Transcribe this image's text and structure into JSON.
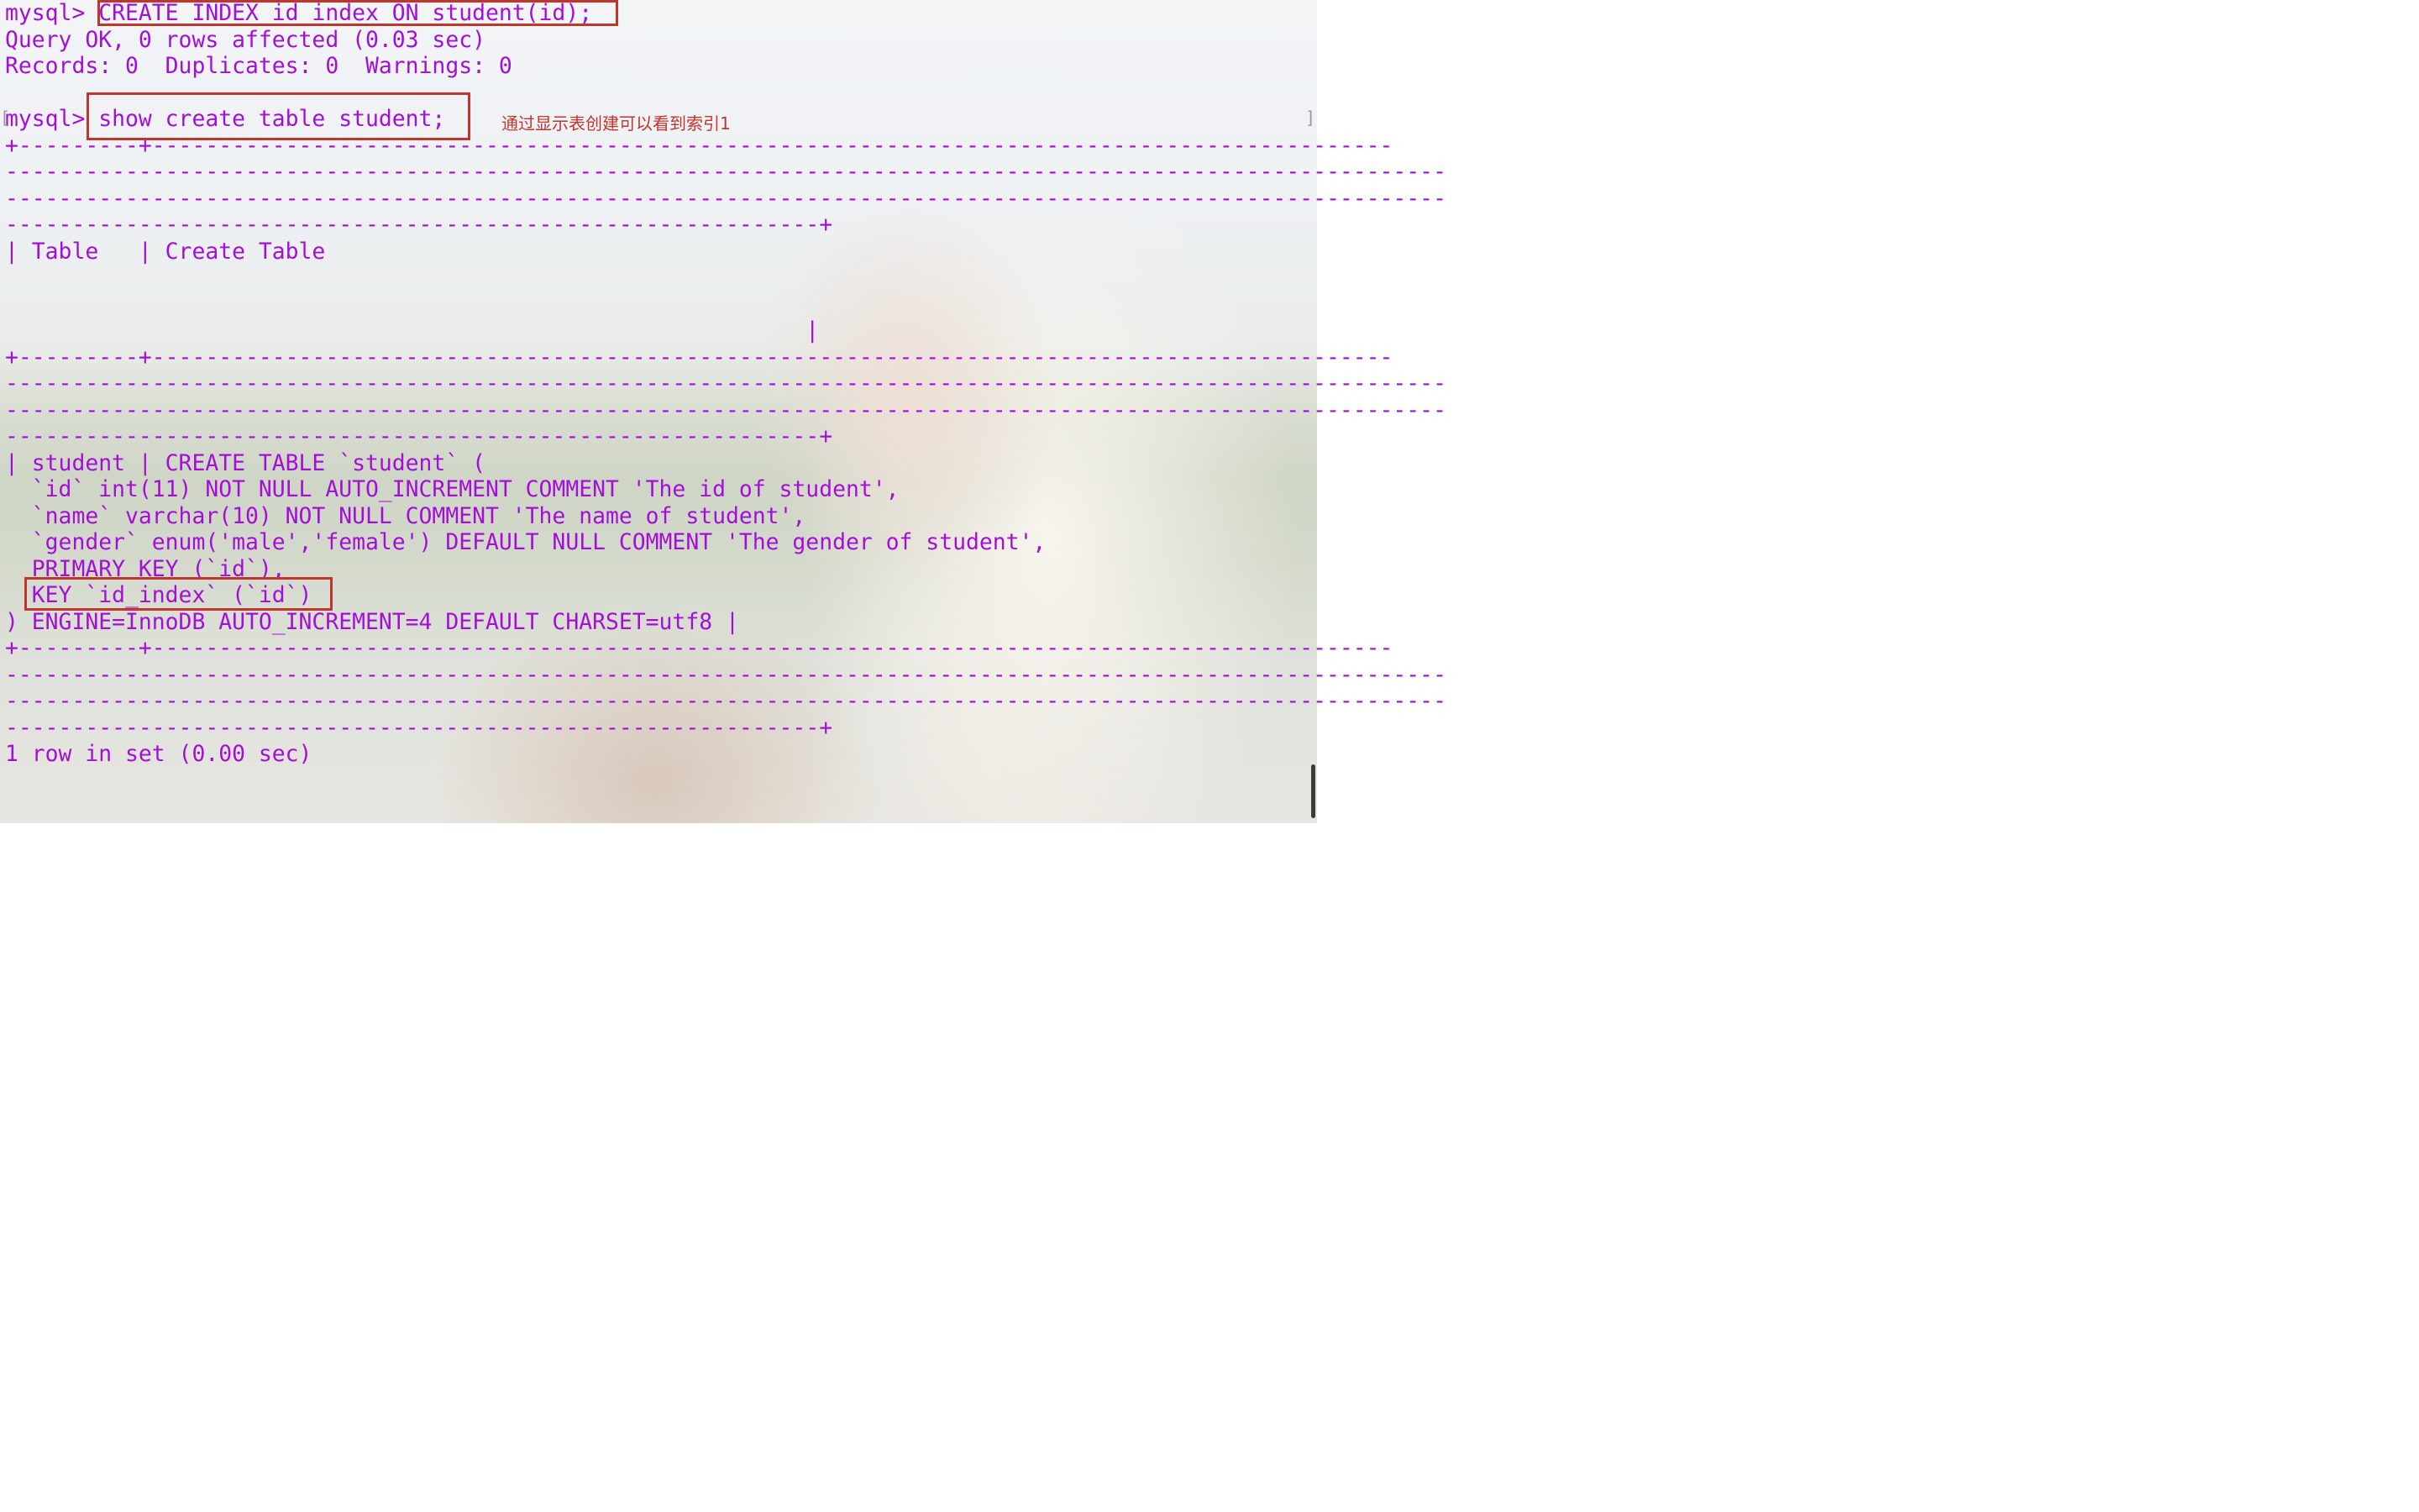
{
  "terminal": {
    "lines": [
      {
        "text": "mysql> CREATE INDEX id_index ON student(id);"
      },
      {
        "text": "Query OK, 0 rows affected (0.03 sec)"
      },
      {
        "text": "Records: 0  Duplicates: 0  Warnings: 0"
      },
      {
        "text": ""
      },
      {
        "text": "mysql> show create table student;"
      },
      {
        "text": "+---------+---------------------------------------------------------------------------------------------"
      },
      {
        "text": "------------------------------------------------------------------------------------------------------------"
      },
      {
        "text": "------------------------------------------------------------------------------------------------------------"
      },
      {
        "text": "-------------------------------------------------------------+"
      },
      {
        "text": "| Table   | Create Table"
      },
      {
        "text": ""
      },
      {
        "text": ""
      },
      {
        "text": "                                                            |"
      },
      {
        "text": "+---------+---------------------------------------------------------------------------------------------"
      },
      {
        "text": "------------------------------------------------------------------------------------------------------------"
      },
      {
        "text": "------------------------------------------------------------------------------------------------------------"
      },
      {
        "text": "-------------------------------------------------------------+"
      },
      {
        "text": "| student | CREATE TABLE `student` ("
      },
      {
        "text": "  `id` int(11) NOT NULL AUTO_INCREMENT COMMENT 'The id of student',"
      },
      {
        "text": "  `name` varchar(10) NOT NULL COMMENT 'The name of student',"
      },
      {
        "text": "  `gender` enum('male','female') DEFAULT NULL COMMENT 'The gender of student',"
      },
      {
        "text": "  PRIMARY KEY (`id`),"
      },
      {
        "text": "  KEY `id_index` (`id`)"
      },
      {
        "text": ") ENGINE=InnoDB AUTO_INCREMENT=4 DEFAULT CHARSET=utf8 |"
      },
      {
        "text": "+---------+---------------------------------------------------------------------------------------------"
      },
      {
        "text": "------------------------------------------------------------------------------------------------------------"
      },
      {
        "text": "------------------------------------------------------------------------------------------------------------"
      },
      {
        "text": "-------------------------------------------------------------+"
      },
      {
        "text": "1 row in set (0.00 sec)"
      }
    ]
  },
  "annotation": "通过显示表创建可以看到索引1",
  "colors": {
    "terminal_text": "#a40fd8",
    "highlight_box": "#c0362c",
    "annotation_text": "#c0362c"
  }
}
